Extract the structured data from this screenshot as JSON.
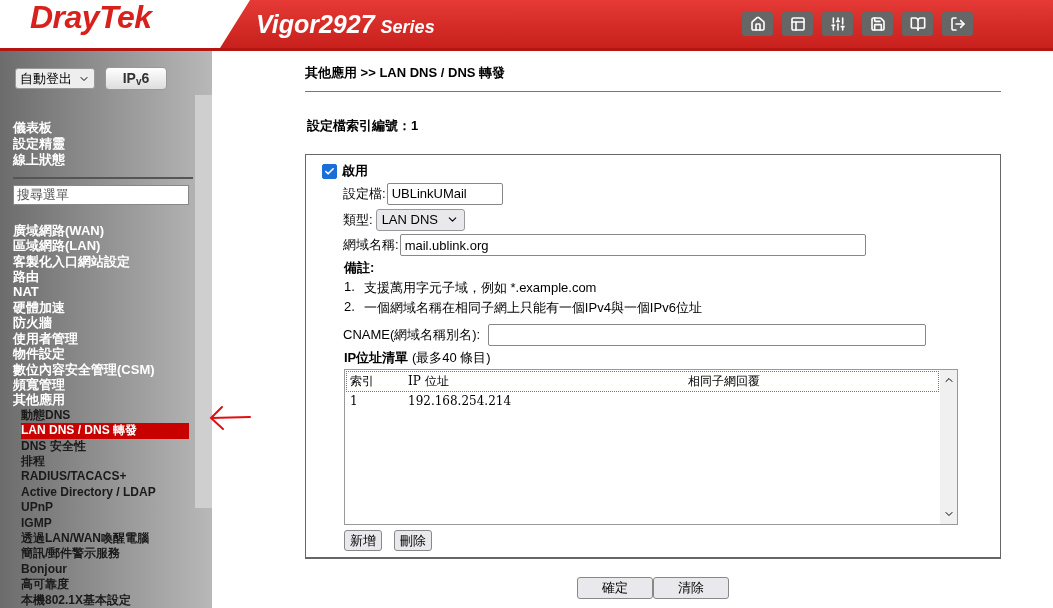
{
  "header": {
    "brand": "DrayTek",
    "model": "Vigor2927",
    "series": "Series",
    "icons": [
      {
        "kind": "home"
      },
      {
        "kind": "layout"
      },
      {
        "kind": "sliders"
      },
      {
        "kind": "save"
      },
      {
        "kind": "book"
      },
      {
        "kind": "logout"
      }
    ]
  },
  "sidebar": {
    "logout_select": "自動登出",
    "ipv6_button": "IP$_{v}$6",
    "top_items": [
      "儀表板",
      "設定精靈",
      "線上狀態"
    ],
    "search": {
      "placeholder": "搜尋選單"
    },
    "items": [
      {
        "label": "廣域網路(WAN)",
        "selected": false
      },
      {
        "label": "區域網路(LAN)",
        "selected": false
      },
      {
        "label": "客製化入口網站設定",
        "selected": false
      },
      {
        "label": "路由",
        "selected": false
      },
      {
        "label": "NAT",
        "selected": false
      },
      {
        "label": "硬體加速",
        "selected": false
      },
      {
        "label": "防火牆",
        "selected": false
      },
      {
        "label": "使用者管理",
        "selected": false
      },
      {
        "label": "物件設定",
        "selected": false
      },
      {
        "label": "數位內容安全管理(CSM)",
        "selected": false
      },
      {
        "label": "頻寬管理",
        "selected": false
      },
      {
        "label": "其他應用",
        "selected": false,
        "children": [
          {
            "label": "動態DNS",
            "selected": false
          },
          {
            "label": "LAN DNS / DNS 轉發",
            "selected": true
          },
          {
            "label": "DNS 安全性",
            "selected": false
          },
          {
            "label": "排程",
            "selected": false
          },
          {
            "label": "RADIUS/TACACS+",
            "selected": false
          },
          {
            "label": "Active Directory / LDAP",
            "selected": false
          },
          {
            "label": "UPnP",
            "selected": false
          },
          {
            "label": "IGMP",
            "selected": false
          },
          {
            "label": "透過LAN/WAN喚醒電腦",
            "selected": false
          },
          {
            "label": "簡訊/郵件警示服務",
            "selected": false
          },
          {
            "label": "Bonjour",
            "selected": false
          },
          {
            "label": "高可靠度",
            "selected": false
          },
          {
            "label": "本機802.1X基本設定",
            "selected": false
          }
        ]
      }
    ]
  },
  "breadcrumb": "其他應用 >> LAN DNS / DNS 轉發",
  "profile_index": "設定檔索引編號：1",
  "form": {
    "enable": {
      "label": "啟用",
      "checked": true
    },
    "profile": {
      "label": "設定檔:",
      "value": "UBLinkUMail"
    },
    "type": {
      "label": "類型:",
      "value": "LAN DNS"
    },
    "domain": {
      "label": "網域名稱:",
      "value": "mail.ublink.org"
    },
    "notes_title": "備註:",
    "notes": [
      {
        "num": "1.",
        "text": "支援萬用字元子域，例如 *.example.com"
      },
      {
        "num": "2.",
        "text": "一個網域名稱在相同子網上只能有一個IPv4與一個IPv6位址"
      }
    ],
    "cname": {
      "label": "CNAME(網域名稱別名):"
    },
    "ip_list_title": "**IP位址清單** (最多40 條目)",
    "ip_list": {
      "columns": [
        "索引",
        "IP 位址",
        "相同子網回覆"
      ],
      "rows": [
        [
          "1",
          "192.168.254.214"
        ]
      ]
    },
    "list_buttons": [
      "新增",
      "刪除"
    ]
  },
  "buttons": [
    "確定",
    "清除"
  ]
}
